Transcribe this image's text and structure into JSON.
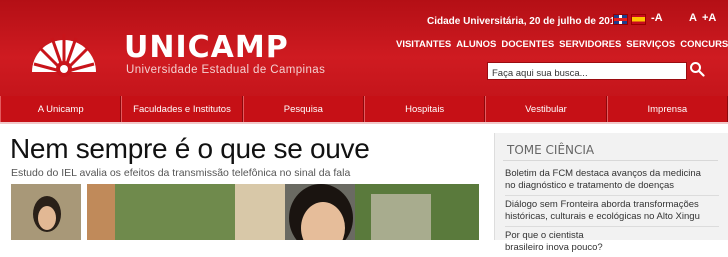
{
  "brand": {
    "name": "UNICAMP",
    "tagline": "Universidade Estadual de Campinas"
  },
  "topbar": {
    "date": "Cidade Universitária, 20 de julho de 2015",
    "font_controls": [
      "-A",
      "A",
      "+A"
    ]
  },
  "topnav": [
    "VISITANTES",
    "ALUNOS",
    "DOCENTES",
    "SERVIDORES",
    "SERVIÇOS",
    "CONCURSOS"
  ],
  "search": {
    "placeholder": "Faça aqui sua busca..."
  },
  "mainnav": [
    "A Unicamp",
    "Faculdades e Institutos",
    "Pesquisa",
    "Hospitais",
    "Vestibular",
    "Imprensa"
  ],
  "article": {
    "headline": "Nem sempre é o que se ouve",
    "subhead": "Estudo do IEL avalia os efeitos da transmissão telefônica no sinal da fala"
  },
  "sidebar": {
    "title": "TOME CIÊNCIA",
    "items": [
      "Boletim da FCM destaca avanços da medicina\nno diagnóstico e tratamento de doenças",
      "Diálogo sem Fronteira aborda transformações\nhistóricas, culturais e ecológicas no Alto Xingu",
      "Por que o cientista\nbrasileiro inova pouco?"
    ]
  },
  "colors": {
    "brand_red": "#c8141a",
    "nav_red": "#c61016"
  }
}
